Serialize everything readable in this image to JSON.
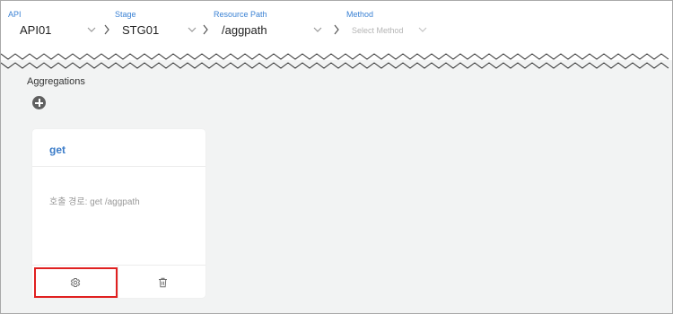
{
  "selectors": {
    "api": {
      "label": "API",
      "value": "API01"
    },
    "stage": {
      "label": "Stage",
      "value": "STG01"
    },
    "resource_path": {
      "label": "Resource Path",
      "value": "/aggpath"
    },
    "method": {
      "label": "Method",
      "placeholder": "Select Method"
    }
  },
  "aggregations": {
    "title": "Aggregations",
    "add_icon": "plus-circle-icon",
    "cards": [
      {
        "name": "get",
        "path_text": "호출 경로: get /aggpath",
        "settings_icon": "gear-icon",
        "delete_icon": "trash-icon"
      }
    ]
  },
  "colors": {
    "accent": "#3b82d4",
    "highlight": "#e02020",
    "background": "#f2f3f3"
  }
}
